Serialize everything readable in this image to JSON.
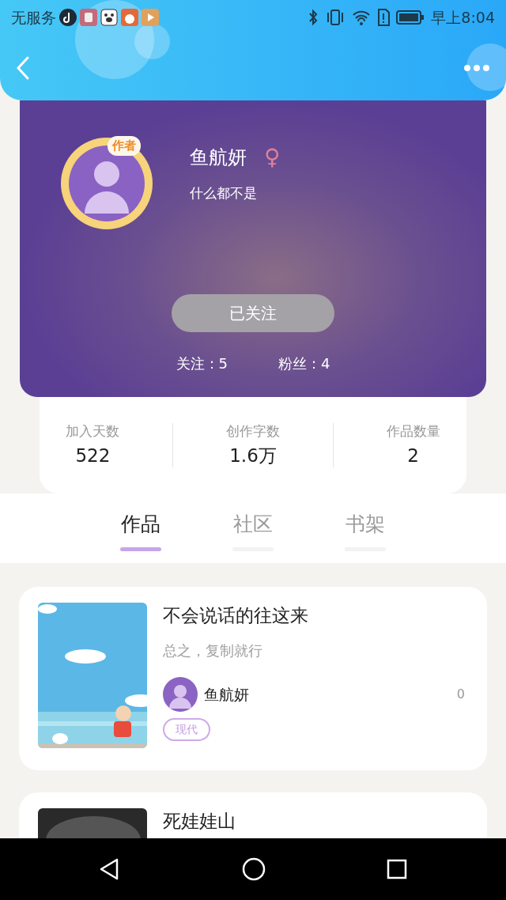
{
  "status_bar": {
    "carrier": "无服务",
    "time": "早上8:04"
  },
  "profile": {
    "badge": "作者",
    "name": "鱼航妍",
    "gender": "♀",
    "bio": "什么都不是",
    "follow_button": {
      "label": "已关注",
      "followed": true
    },
    "following": "关注：5",
    "fans": "粉丝：4"
  },
  "stats": [
    {
      "label": "加入天数",
      "value": "522"
    },
    {
      "label": "创作字数",
      "value": "1.6万"
    },
    {
      "label": "作品数量",
      "value": "2"
    }
  ],
  "tabs": [
    {
      "label": "作品",
      "selected": true
    },
    {
      "label": "社区",
      "selected": false
    },
    {
      "label": "书架",
      "selected": false
    }
  ],
  "works": [
    {
      "title": "不会说话的往这来",
      "summary": "总之，复制就行",
      "author": "鱼航妍",
      "count": "0",
      "tag": "现代"
    },
    {
      "title": "死娃娃山"
    }
  ]
}
